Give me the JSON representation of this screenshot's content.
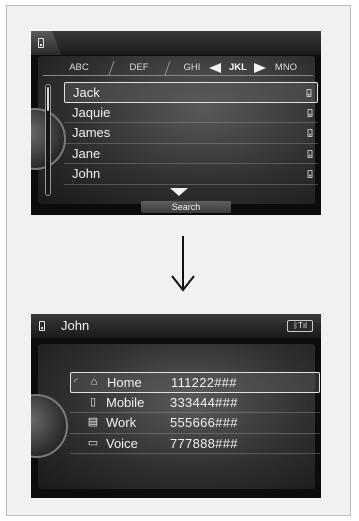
{
  "screen1": {
    "tabs": [
      "ABC",
      "DEF",
      "GHI",
      "JKL",
      "MNO"
    ],
    "active_tab": "JKL",
    "contacts": [
      "Jack",
      "Jaquie",
      "James",
      "Jane",
      "John"
    ],
    "selected_contact": "Jack",
    "search_label": "Search"
  },
  "screen2": {
    "title": "John",
    "status_icon": "bluetooth-signal",
    "entries": [
      {
        "type": "Home",
        "number": "111222###",
        "icon": "home-icon"
      },
      {
        "type": "Mobile",
        "number": "333444###",
        "icon": "mobile-icon"
      },
      {
        "type": "Work",
        "number": "555666###",
        "icon": "work-icon"
      },
      {
        "type": "Voice",
        "number": "777888###",
        "icon": "voice-icon"
      }
    ],
    "selected_entry": "Home"
  },
  "colors": {
    "screen_bg": "#0c0c0c",
    "text": "#f0f0f0",
    "page_bg": "#f1f1f1"
  }
}
